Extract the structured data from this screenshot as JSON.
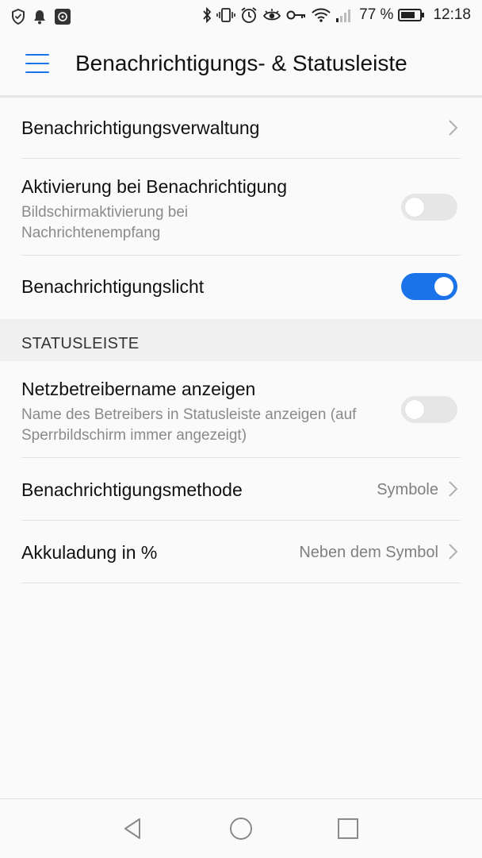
{
  "status_bar": {
    "battery_percent": "77 %",
    "time": "12:18",
    "icons_left": [
      "shield-icon",
      "bell-icon",
      "app-notification-icon"
    ],
    "icons_right": [
      "bluetooth-icon",
      "vibrate-icon",
      "alarm-icon",
      "eye-comfort-icon",
      "key-icon",
      "wifi-icon",
      "signal-icon",
      "battery-icon"
    ]
  },
  "app_bar": {
    "title": "Benachrichtigungs- & Statusleiste"
  },
  "settings": {
    "notification_management": {
      "title": "Benachrichtigungsverwaltung"
    },
    "wake_on_notification": {
      "title": "Aktivierung bei Benachrichtigung",
      "subtitle": "Bildschirmaktivierung bei Nachrichtenempfang",
      "enabled": false
    },
    "notification_light": {
      "title": "Benachrichtigungslicht",
      "enabled": true
    }
  },
  "statusbar_section": {
    "header": "STATUSLEISTE",
    "carrier_name": {
      "title": "Netzbetreibername anzeigen",
      "subtitle": "Name des Betreibers in Statusleiste anzeigen (auf Sperrbildschirm immer angezeigt)",
      "enabled": false
    },
    "notification_method": {
      "title": "Benachrichtigungsmethode",
      "value": "Symbole"
    },
    "battery_percentage": {
      "title": "Akkuladung in %",
      "value": "Neben dem Symbol"
    }
  },
  "colors": {
    "accent": "#1a73e8",
    "toggle_off": "#e6e6e6",
    "secondary_text": "#8a8a8a"
  }
}
